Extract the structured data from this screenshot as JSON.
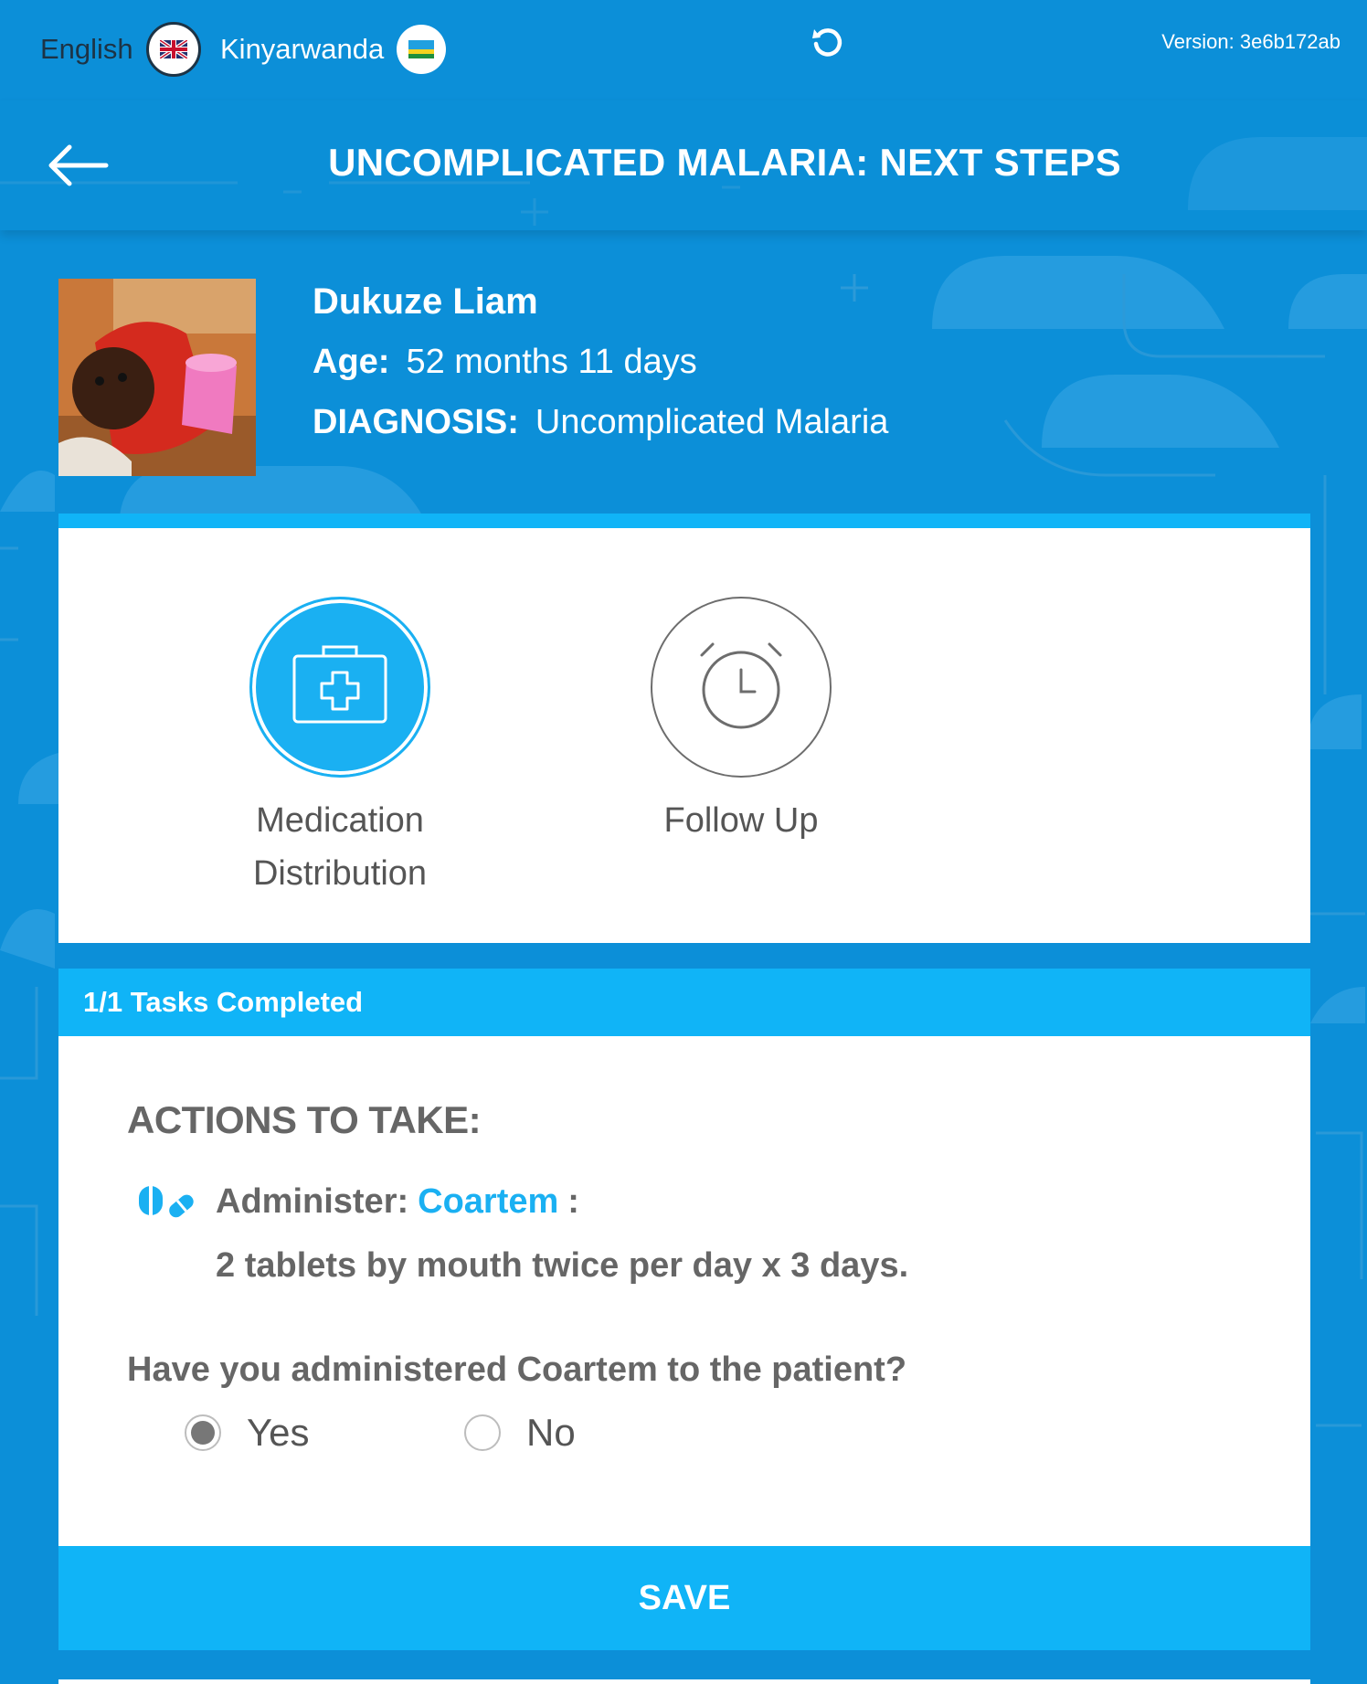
{
  "topbar": {
    "lang_english": "English",
    "lang_kinyarwanda": "Kinyarwanda",
    "version": "Version: 3e6b172ab",
    "icons": [
      "uk-flag-icon",
      "rwanda-flag-icon",
      "refresh-icon"
    ]
  },
  "header": {
    "title": "UNCOMPLICATED MALARIA: NEXT STEPS",
    "back_icon": "arrow-left-icon"
  },
  "patient": {
    "name": "Dukuze Liam",
    "age_label": "Age:",
    "age_value": "52 months 11 days",
    "diagnosis_label": "DIAGNOSIS:",
    "diagnosis_value": "Uncomplicated Malaria"
  },
  "tabs": [
    {
      "line1": "Medication",
      "line2": "Distribution",
      "icon": "medical-kit-icon",
      "active": true
    },
    {
      "line1": "Follow Up",
      "line2": "",
      "icon": "alarm-clock-icon",
      "active": false
    }
  ],
  "tasks": {
    "status": "1/1 Tasks Completed"
  },
  "actions": {
    "title": "ACTIONS TO TAKE:",
    "administer_label": "Administer:",
    "drug": "Coartem",
    "colon": ":",
    "dose": "2 tablets by mouth twice per day x 3 days.",
    "question": "Have you administered Coartem to the patient?",
    "options": [
      {
        "label": "Yes",
        "selected": true
      },
      {
        "label": "No",
        "selected": false
      }
    ]
  },
  "save_label": "SAVE",
  "colors": {
    "background": "#0c8fd8",
    "accent": "#10b4f7",
    "text_gray": "#666666"
  }
}
